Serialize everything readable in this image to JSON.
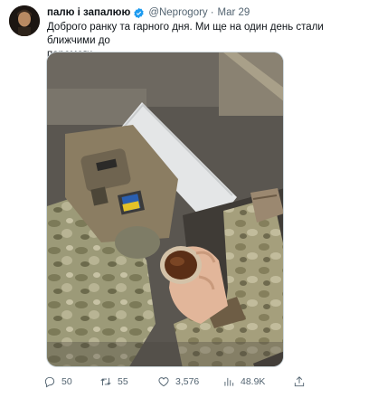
{
  "tweet": {
    "author_name": "палю і запалюю",
    "handle": "@Neprogory",
    "separator": "·",
    "date": "Mar 29",
    "text_line1": "Доброго ранку та гарного дня. Ми ще на один день стали ближчими до",
    "text_line2": "перемоги.",
    "verified_color": "#1d9bf0"
  },
  "actions": {
    "replies": "50",
    "retweets": "55",
    "likes": "3,576",
    "views": "48.9K"
  },
  "icons": [
    "verified-badge-icon",
    "reply-icon",
    "retweet-icon",
    "like-icon",
    "views-icon",
    "share-icon"
  ]
}
